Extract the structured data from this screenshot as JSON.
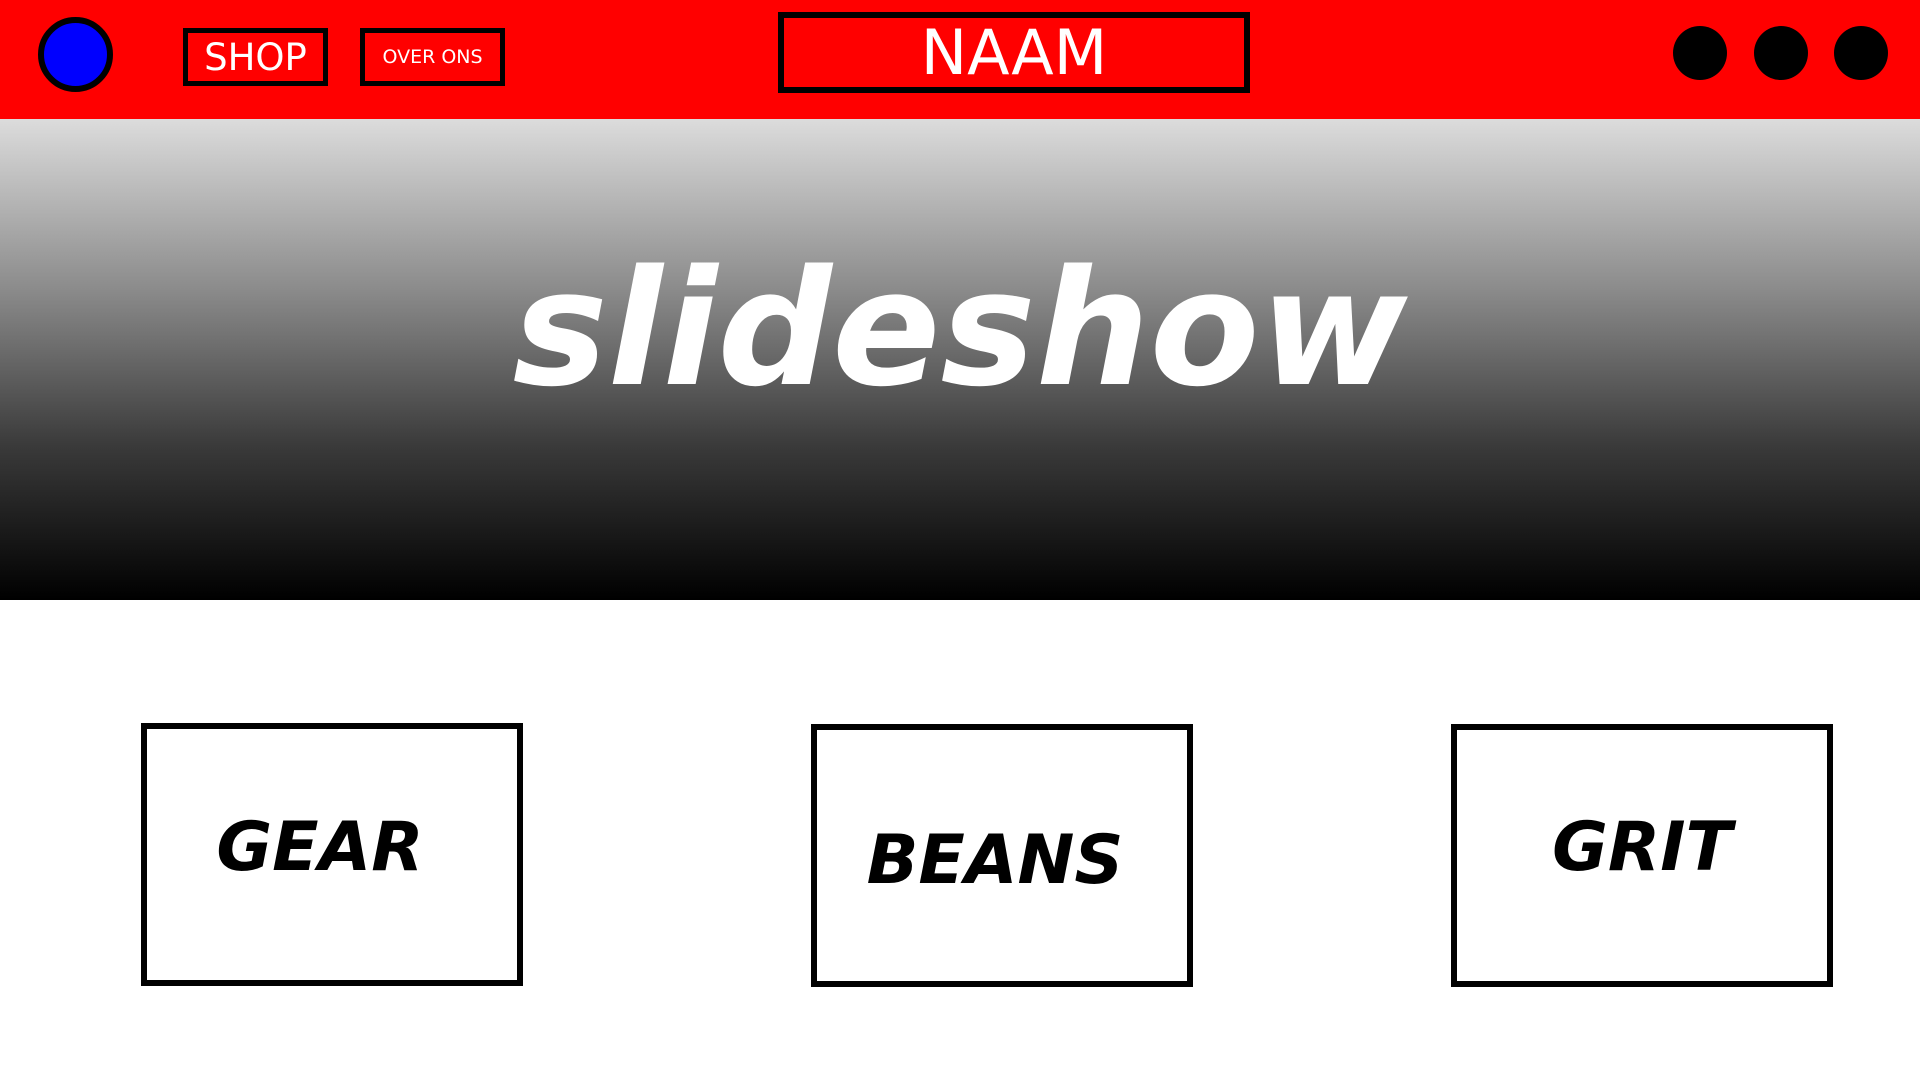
{
  "header": {
    "logo_color": "#0000ff",
    "nav": {
      "shop_label": "SHOP",
      "about_label": "OVER ONS"
    },
    "site_name": "NAAM",
    "dot_icons": [
      "circle-icon",
      "circle-icon",
      "circle-icon"
    ],
    "background_color": "#ff0000"
  },
  "hero": {
    "title": "slideshow"
  },
  "categories": {
    "items": [
      {
        "label": "GEAR"
      },
      {
        "label": "BEANS"
      },
      {
        "label": "GRIT"
      }
    ]
  }
}
